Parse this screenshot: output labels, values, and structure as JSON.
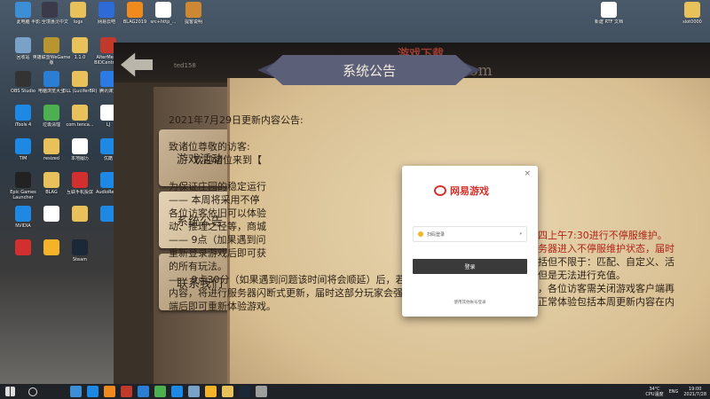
{
  "desktop": {
    "icons": [
      {
        "label": "此电脑",
        "color": "#3c8fd6"
      },
      {
        "label": "半影:全境惠灵中文",
        "color": "#3a3a4a"
      },
      {
        "label": "logs",
        "color": "#e8c15a"
      },
      {
        "label": "网易云吧",
        "color": "#2f6bd6"
      },
      {
        "label": "BLAG2019",
        "color": "#f08a1c"
      },
      {
        "label": "src+http_...",
        "color": "#ffffff"
      },
      {
        "label": "提客说明",
        "color": "#cc8833"
      },
      {
        "label": "回收站",
        "color": "#7aa2c8"
      },
      {
        "label": "英雄联盟WeGame版",
        "color": "#b8952e"
      },
      {
        "label": "1.1.0",
        "color": "#e8c15a"
      },
      {
        "label": "AlterMedia BIDCentral 3",
        "color": "#c0392b"
      },
      {
        "label": "OBS Studio",
        "color": "#333333"
      },
      {
        "label": "电脑浏览大全",
        "color": "#2a7fd4"
      },
      {
        "label": "DLL (LuciferBR)",
        "color": "#e8c15a"
      },
      {
        "label": "腾讯课堂",
        "color": "#2c7be5"
      },
      {
        "label": "iTools 4",
        "color": "#1e88e5"
      },
      {
        "label": "垃圾清理",
        "color": "#4caf50"
      },
      {
        "label": "com.tenca...",
        "color": "#e8c15a"
      },
      {
        "label": "LJ",
        "color": "#ffffff"
      },
      {
        "label": "TIM",
        "color": "#1e88e5"
      },
      {
        "label": "resized",
        "color": "#e8c15a"
      },
      {
        "label": "本地履历",
        "color": "#ffffff"
      },
      {
        "label": "优酷",
        "color": "#1e88e5"
      },
      {
        "label": "Epic Games Launcher",
        "color": "#222222"
      },
      {
        "label": "BLAG",
        "color": "#e8c15a"
      },
      {
        "label": "互联手机投屏",
        "color": "#d32f2f"
      },
      {
        "label": "AudioRec...",
        "color": "#1e88e5"
      },
      {
        "label": "NVIDIA",
        "color": "#1e88e5"
      },
      {
        "label": "",
        "color": "#ffffff"
      },
      {
        "label": "",
        "color": "#e8c15a"
      },
      {
        "label": "",
        "color": "#1e88e5"
      },
      {
        "label": "",
        "color": "#d32f2f"
      },
      {
        "label": "",
        "color": "#f5b428"
      },
      {
        "label": "Steam",
        "color": "#1b2838"
      }
    ],
    "right_icons": [
      {
        "label": "新建 RTF 文档",
        "color": "#ffffff"
      },
      {
        "label": "slot0000",
        "color": "#e8c15a"
      }
    ]
  },
  "game": {
    "watermark_top": "游戏下载",
    "watermark_url": "jetb163.com",
    "username": "ted158",
    "tabs": [
      {
        "label": "游戏活动",
        "active": false
      },
      {
        "label": "系统公告",
        "active": true
      },
      {
        "label": "联系我们",
        "active": false
      }
    ],
    "title": "系统公告",
    "notice_lines": [
      {
        "text": "2021年7月29日更新内容公告:",
        "style": "normal"
      },
      {
        "text": "",
        "style": "normal"
      },
      {
        "text": "致诸位尊敬的访客:",
        "style": "normal"
      },
      {
        "text": "欢迎诸位来到【",
        "style": "indent"
      },
      {
        "text": "",
        "style": "normal"
      },
      {
        "text": "为保证庄园的稳定运行",
        "style": "normal"
      },
      {
        "text": "—— 本周将采用不停",
        "style": "normal"
      },
      {
        "text": "各位访客依旧可以体验",
        "style": "normal"
      },
      {
        "text": "动、推理之径等，商城",
        "style": "normal"
      },
      {
        "text": "—— 9点（加果遇到问",
        "style": "normal"
      },
      {
        "text": "重新登录游戏后即可获",
        "style": "normal"
      },
      {
        "text": "的所有玩法。",
        "style": "normal"
      },
      {
        "text": "—— 9点30分（如果遇到问题该时间将会顺延）后，若仍有访客未更新到本周",
        "style": "normal"
      },
      {
        "text": "内容，将进行服务器闪断式更新，届时这部分玩家会强制掉线一次，重启客户",
        "style": "normal"
      },
      {
        "text": "端后即可重新体验游戏。",
        "style": "normal"
      }
    ],
    "right_fragments": [
      {
        "text": "四上午7:30进行不停服维护。",
        "red": true
      },
      {
        "text": "务器进入不停服维护状态，届时",
        "red": true
      },
      {
        "text": "括但不限于：匹配、自定义、活",
        "red": false
      },
      {
        "text": "但是无法进行充值。",
        "red": false
      },
      {
        "text": "，各位访客需关闭游戏客户端再",
        "red": false
      },
      {
        "text": "正常体验包括本周更新内容在内",
        "red": false
      }
    ]
  },
  "login": {
    "brand": "网易游戏",
    "account": "扫码登录",
    "login_button": "登录",
    "other_login": "使用其他帐号登录",
    "close": "×"
  },
  "taskbar": {
    "apps": [
      "#3c8fd6",
      "#1e88e5",
      "#f08a1c",
      "#c0392b",
      "#2a7fd4",
      "#4caf50",
      "#1e88e5",
      "#7aa2c8",
      "#f5b428",
      "#e8c15a",
      "#1b2838",
      "#9e9e9e"
    ],
    "weather": "34°C",
    "weather_sub": "CPU温度",
    "lang": "ENG",
    "time": "19:00",
    "date": "2021/7/28"
  }
}
